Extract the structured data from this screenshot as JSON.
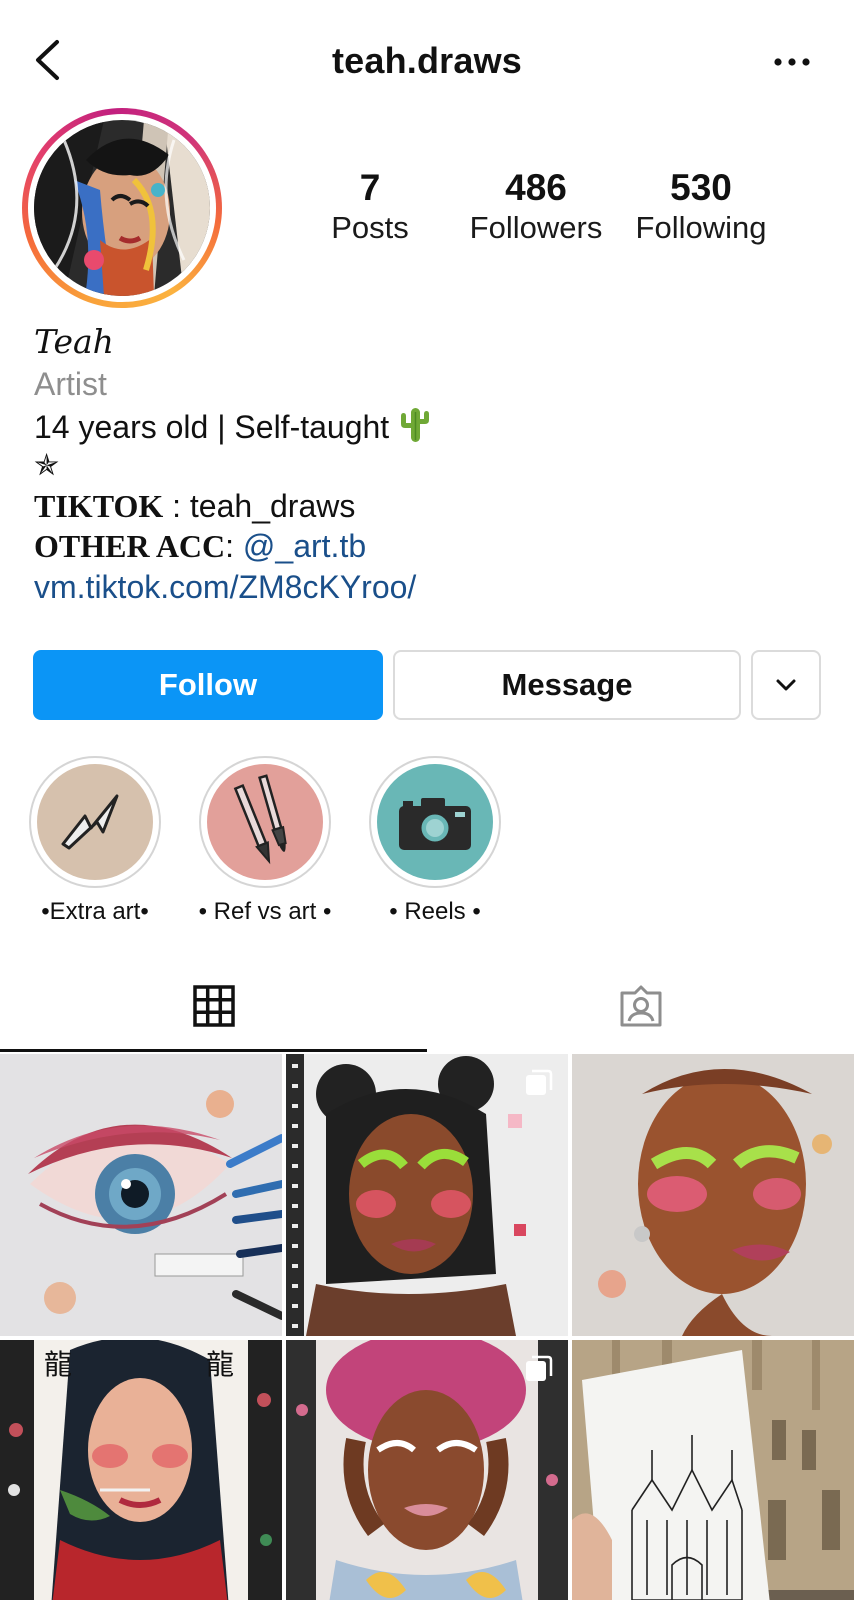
{
  "header": {
    "username": "teah.draws",
    "back_icon": "chevron-left-icon",
    "more_icon": "ellipsis-icon"
  },
  "profile": {
    "stats": [
      {
        "value": "7",
        "label": "Posts"
      },
      {
        "value": "486",
        "label": "Followers"
      },
      {
        "value": "530",
        "label": "Following"
      }
    ],
    "bio": {
      "name": "Teah",
      "category": "Artist",
      "line1": "14 years old | Self-taught",
      "line1_emoji": "🌵",
      "star": "✯",
      "tiktok_label": "TIKTOK",
      "tiktok_sep": " : ",
      "tiktok_value": "teah_draws",
      "other_label": "OTHER ACC",
      "other_sep": ": ",
      "other_value": "@_art.tb",
      "link": "vm.tiktok.com/ZM8cKYroo/"
    }
  },
  "actions": {
    "follow": "Follow",
    "message": "Message"
  },
  "highlights": [
    {
      "label": "•Extra art•"
    },
    {
      "label": "• Ref vs art •"
    },
    {
      "label": "• Reels •"
    }
  ],
  "tabs": {
    "active": "grid",
    "items": [
      "grid-icon",
      "tagged-icon"
    ]
  },
  "colors": {
    "follow_button": "#0b95f6",
    "link": "#1a4f8a",
    "secondary_text": "#8e8e8e"
  }
}
